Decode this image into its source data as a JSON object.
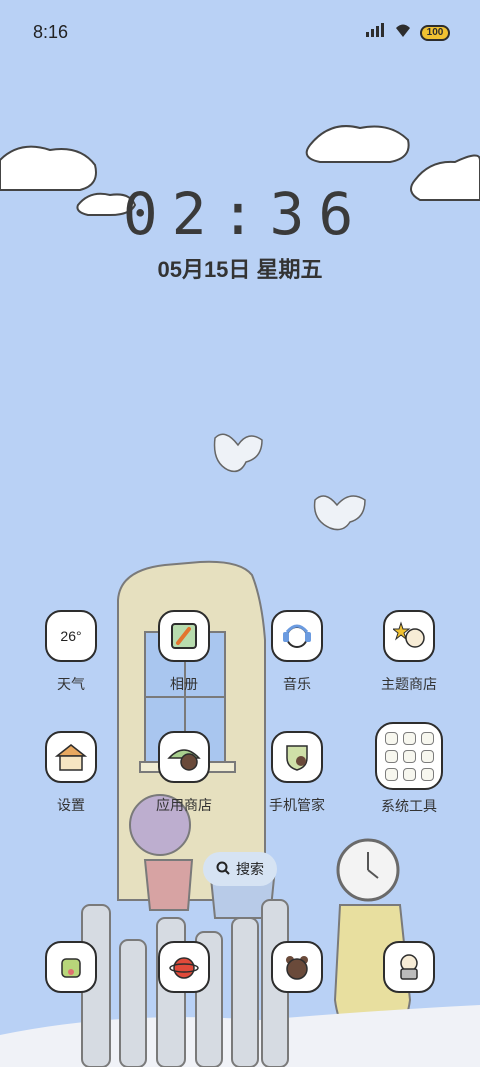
{
  "status_bar": {
    "time": "8:16",
    "battery": "100",
    "icons": [
      "signal-icon",
      "wifi-icon",
      "battery-icon"
    ]
  },
  "lockscreen": {
    "clock": "02:36",
    "date": "05月15日 星期五"
  },
  "apps": [
    {
      "label": "天气",
      "tile_text": "26°",
      "icon": "weather-icon"
    },
    {
      "label": "相册",
      "icon": "gallery-icon"
    },
    {
      "label": "音乐",
      "icon": "music-icon"
    },
    {
      "label": "主题商店",
      "icon": "theme-store-icon"
    },
    {
      "label": "设置",
      "icon": "settings-icon"
    },
    {
      "label": "应用商店",
      "icon": "app-store-icon"
    },
    {
      "label": "手机管家",
      "icon": "phone-manager-icon"
    },
    {
      "label": "系统工具",
      "icon": "system-tools-folder-icon"
    }
  ],
  "search": {
    "label": "搜索"
  },
  "dock": [
    {
      "icon": "dock-phone-icon"
    },
    {
      "icon": "dock-browser-icon"
    },
    {
      "icon": "dock-bear-icon"
    },
    {
      "icon": "dock-camera-icon"
    }
  ],
  "colors": {
    "sky": "#b9d1f5",
    "house": "#e6e0bf",
    "battery": "#f1c232"
  }
}
